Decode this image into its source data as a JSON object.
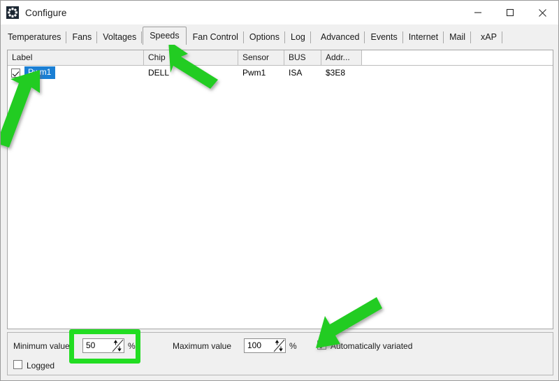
{
  "window": {
    "title": "Configure",
    "app_icon": "fan-icon",
    "controls": {
      "minimize": "minimize-icon",
      "maximize": "maximize-icon",
      "close": "close-icon"
    }
  },
  "tabs": [
    {
      "label": "Temperatures",
      "selected": false
    },
    {
      "label": "Fans",
      "selected": false
    },
    {
      "label": "Voltages",
      "selected": false
    },
    {
      "label": "Speeds",
      "selected": true
    },
    {
      "label": "Fan Control",
      "selected": false
    },
    {
      "label": "Options",
      "selected": false
    },
    {
      "label": "Log",
      "selected": false
    },
    {
      "label": "Advanced",
      "selected": false
    },
    {
      "label": "Events",
      "selected": false
    },
    {
      "label": "Internet",
      "selected": false
    },
    {
      "label": "Mail",
      "selected": false
    },
    {
      "label": "xAP",
      "selected": false
    }
  ],
  "list": {
    "columns": [
      "Label",
      "Chip",
      "Sensor",
      "BUS",
      "Addr...",
      ""
    ],
    "rows": [
      {
        "checked": true,
        "label": "Pwm1",
        "chip": "DELL",
        "sensor": "Pwm1",
        "bus": "ISA",
        "addr": "$3E8",
        "selected": true
      }
    ]
  },
  "bottom": {
    "minimum_label": "Minimum value",
    "minimum_value": "50",
    "minimum_unit": "%",
    "maximum_label": "Maximum value",
    "maximum_value": "100",
    "maximum_unit": "%",
    "logged_label": "Logged",
    "logged_checked": false,
    "auto_varied_label": "Automatically variated",
    "auto_varied_checked": true
  },
  "annotations": {
    "highlight_color": "#22dd22",
    "arrow_color": "#22cc22",
    "items": [
      {
        "name": "arrow-to-speeds-tab",
        "target": "Speeds tab"
      },
      {
        "name": "arrow-to-pwm1-row",
        "target": "Pwm1 list entry"
      },
      {
        "name": "arrow-to-auto-varied",
        "target": "Automatically variated checkbox"
      },
      {
        "name": "highlight-minimum-value",
        "target": "Minimum value spinner"
      }
    ]
  }
}
